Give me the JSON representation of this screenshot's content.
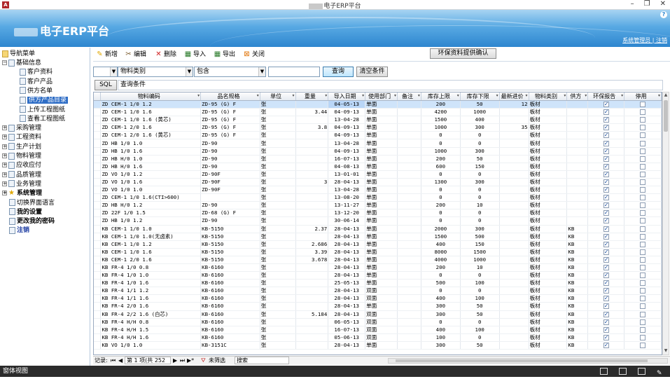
{
  "window": {
    "title": "电子ERP平台",
    "app_icon_letter": "A",
    "minimize": "–",
    "restore": "❐",
    "close": "✕"
  },
  "banner": {
    "brand": "电子ERP平台",
    "help": "?",
    "user_link": "系统管理员",
    "logout_link": "| 注销"
  },
  "nav": {
    "root": "导航菜单",
    "items": [
      {
        "label": "基础信息",
        "level": 1,
        "expander": "−"
      },
      {
        "label": "客户资料",
        "level": 2
      },
      {
        "label": "客户产品",
        "level": 2
      },
      {
        "label": "供方名单",
        "level": 2
      },
      {
        "label": "供方产品目录",
        "level": 2,
        "selected": true
      },
      {
        "label": "上传工程图纸",
        "level": 2
      },
      {
        "label": "查看工程图纸",
        "level": 2
      },
      {
        "label": "采购管理",
        "level": 1,
        "expander": "+"
      },
      {
        "label": "工程资料",
        "level": 1,
        "expander": "+"
      },
      {
        "label": "生产计划",
        "level": 1,
        "expander": "+"
      },
      {
        "label": "物料管理",
        "level": 1,
        "expander": "+"
      },
      {
        "label": "应收应付",
        "level": 1,
        "expander": "+"
      },
      {
        "label": "品质管理",
        "level": 1,
        "expander": "+"
      },
      {
        "label": "业务管理",
        "level": 1,
        "expander": "+"
      },
      {
        "label": "系统管理",
        "level": 1,
        "expander": "+",
        "bold": true,
        "star": true
      },
      {
        "label": "切换界面语言",
        "level": 1
      },
      {
        "label": "我的设置",
        "level": 1,
        "bold": true
      },
      {
        "label": "更改我的密码",
        "level": 1,
        "bold": true
      },
      {
        "label": "注销",
        "level": 1,
        "blue": true
      }
    ]
  },
  "toolbar": {
    "add": "新增",
    "edit": "编辑",
    "delete": "删除",
    "import": "导入",
    "export": "导出",
    "close": "关闭",
    "confirm": "环保资料提供确认"
  },
  "filter": {
    "field_prefix": "",
    "field": "物料类别",
    "operator": "包含",
    "value": "",
    "search_btn": "查询",
    "clear_btn": "清空条件",
    "sql_btn": "SQL",
    "sql_label": "查询条件"
  },
  "columns": [
    "物料编码",
    "品名规格",
    "单位",
    "重量",
    "导入日期",
    "使用部门",
    "备注",
    "库存上限",
    "库存下限",
    "最新进价",
    "物料类别",
    "供方",
    "环保报告",
    "停用"
  ],
  "rows": [
    [
      "ZD CEM-1 1/0 1.2",
      "ZD-95 (G) F",
      "张",
      "",
      "04-05-13",
      "单面",
      "",
      "200",
      "50",
      "12",
      "板材",
      "",
      1,
      0
    ],
    [
      "ZD CEM-1 1/0 1.6",
      "ZD-95 (G) F",
      "张",
      "3.44",
      "04-09-13",
      "单面",
      "",
      "4200",
      "1000",
      "",
      "板材",
      "",
      1,
      0
    ],
    [
      "ZD CEM-1 1/0 1.6 (黄芯)",
      "ZD-95 (G) F",
      "张",
      "",
      "13-04-28",
      "单面",
      "",
      "1500",
      "400",
      "",
      "板材",
      "",
      1,
      0
    ],
    [
      "ZD CEM-1 2/0 1.6",
      "ZD-95 (G) F",
      "张",
      "3.8",
      "04-09-13",
      "单面",
      "",
      "1000",
      "300",
      "35",
      "板材",
      "",
      1,
      0
    ],
    [
      "ZD CEM-1 2/0 1.6 (黄芯)",
      "ZD-95 (G) F",
      "张",
      "",
      "04-09-13",
      "单面",
      "",
      "0",
      "0",
      "",
      "板材",
      "",
      1,
      0
    ],
    [
      "ZD HB 1/0 1.0",
      "ZD-90",
      "张",
      "",
      "13-04-28",
      "单面",
      "",
      "0",
      "0",
      "",
      "板材",
      "",
      1,
      0
    ],
    [
      "ZD HB 1/0 1.6",
      "ZD-90",
      "张",
      "",
      "04-09-13",
      "单面",
      "",
      "1000",
      "300",
      "",
      "板材",
      "",
      1,
      0
    ],
    [
      "ZD HB H/0 1.0",
      "ZD-90",
      "张",
      "",
      "16-07-13",
      "单面",
      "",
      "200",
      "50",
      "",
      "板材",
      "",
      1,
      0
    ],
    [
      "ZD HB H/0 1.6",
      "ZD-90",
      "张",
      "",
      "04-08-13",
      "单面",
      "",
      "600",
      "150",
      "",
      "板材",
      "",
      1,
      0
    ],
    [
      "ZD VO  1/0 1.2",
      "ZD-90F",
      "张",
      "",
      "13-01-01",
      "单面",
      "",
      "0",
      "0",
      "",
      "板材",
      "",
      1,
      0
    ],
    [
      "ZD VO  1/0 1.6",
      "ZD-90F",
      "张",
      "3",
      "28-04-13",
      "单面",
      "",
      "1300",
      "300",
      "",
      "板材",
      "",
      1,
      0
    ],
    [
      "ZD VO 1/0 1.0",
      "ZD-90F",
      "张",
      "",
      "13-04-28",
      "单面",
      "",
      "0",
      "0",
      "",
      "板材",
      "",
      1,
      0
    ],
    [
      "ZD CEM-1 1/0 1.6(CTI>600)",
      "",
      "张",
      "",
      "13-08-20",
      "单面",
      "",
      "0",
      "0",
      "",
      "板材",
      "",
      1,
      0
    ],
    [
      "ZD HB H/0 1.2",
      "ZD-90",
      "张",
      "",
      "13-11-27",
      "单面",
      "",
      "200",
      "10",
      "",
      "板材",
      "",
      1,
      0
    ],
    [
      "ZD 22F 1/0 1.5",
      "ZD-68 (G) F",
      "张",
      "",
      "13-12-20",
      "单面",
      "",
      "0",
      "0",
      "",
      "板材",
      "",
      1,
      0
    ],
    [
      "ZD HB 1/0 1.2",
      "ZD-90",
      "张",
      "",
      "30-06-14",
      "单面",
      "",
      "0",
      "0",
      "",
      "板材",
      "",
      1,
      0
    ],
    [
      "KB CEM-1 1/0 1.0",
      "KB-5150",
      "张",
      "2.37",
      "28-04-13",
      "单面",
      "",
      "2000",
      "300",
      "",
      "板材",
      "KB",
      1,
      0
    ],
    [
      "KB CEM-1 1/0 1.0(无卤素)",
      "KB-5150",
      "张",
      "",
      "28-04-13",
      "单面",
      "",
      "1500",
      "500",
      "",
      "板材",
      "KB",
      1,
      0
    ],
    [
      "KB CEM-1 1/0 1.2",
      "KB-5150",
      "张",
      "2.686",
      "28-04-13",
      "单面",
      "",
      "400",
      "150",
      "",
      "板材",
      "KB",
      1,
      0
    ],
    [
      "KB CEM-1 1/0 1.6",
      "KB-5150",
      "张",
      "3.39",
      "28-04-13",
      "单面",
      "",
      "8000",
      "1500",
      "",
      "板材",
      "KB",
      1,
      0
    ],
    [
      "KB CEM-1 2/0 1.6",
      "KB-5150",
      "张",
      "3.678",
      "28-04-13",
      "单面",
      "",
      "4000",
      "1000",
      "",
      "板材",
      "KB",
      1,
      0
    ],
    [
      "KB FR-4 1/0 0.8",
      "KB-6160",
      "张",
      "",
      "28-04-13",
      "单面",
      "",
      "200",
      "10",
      "",
      "板材",
      "KB",
      1,
      0
    ],
    [
      "KB FR-4 1/0 1.0",
      "KB-6160",
      "张",
      "",
      "28-04-13",
      "单面",
      "",
      "0",
      "0",
      "",
      "板材",
      "KB",
      1,
      0
    ],
    [
      "KB FR-4 1/0 1.6",
      "KB-6160",
      "张",
      "",
      "25-05-13",
      "单面",
      "",
      "500",
      "100",
      "",
      "板材",
      "KB",
      1,
      0
    ],
    [
      "KB FR-4 1/1 1.2",
      "KB-6160",
      "张",
      "",
      "28-04-13",
      "双面",
      "",
      "0",
      "0",
      "",
      "板材",
      "KB",
      1,
      0
    ],
    [
      "KB FR-4 1/1 1.6",
      "KB-6160",
      "张",
      "",
      "28-04-13",
      "双面",
      "",
      "400",
      "100",
      "",
      "板材",
      "KB",
      1,
      0
    ],
    [
      "KB FR-4 2/0 1.6",
      "KB-6160",
      "张",
      "",
      "28-04-13",
      "单面",
      "",
      "300",
      "50",
      "",
      "板材",
      "KB",
      1,
      0
    ],
    [
      "KB FR-4 2/2 1.6 (白芯)",
      "KB-6160",
      "张",
      "5.184",
      "28-04-13",
      "双面",
      "",
      "300",
      "50",
      "",
      "板材",
      "KB",
      1,
      0
    ],
    [
      "KB FR-4 H/H 0.8",
      "KB-6160",
      "张",
      "",
      "06-05-13",
      "双面",
      "",
      "0",
      "0",
      "",
      "板材",
      "KB",
      1,
      0
    ],
    [
      "KB FR-4 H/H 1.5",
      "KB-6160",
      "张",
      "",
      "16-07-13",
      "双面",
      "",
      "400",
      "100",
      "",
      "板材",
      "KB",
      1,
      0
    ],
    [
      "KB FR-4 H/H 1.6",
      "KB-6160",
      "张",
      "",
      "05-06-13",
      "双面",
      "",
      "100",
      "0",
      "",
      "板材",
      "KB",
      1,
      0
    ],
    [
      "KB VO  1/0 1.0",
      "KB-3151C",
      "张",
      "",
      "28-04-13",
      "单面",
      "",
      "300",
      "50",
      "",
      "板材",
      "KB",
      1,
      0
    ]
  ],
  "recbar": {
    "label": "记录:",
    "first": "⏮",
    "prev": "◀",
    "position": "第 1 项(共 252 ",
    "next": "▶",
    "last": "⏭",
    "new": "▶*",
    "filter_state": "未筛选",
    "search": "搜索"
  },
  "statusbar": {
    "text": "窗体视图"
  },
  "colors": {
    "banner_top": "#a8d4f2",
    "banner_bottom": "#2e86cf",
    "selected_nav": "#2f6ec6",
    "selected_row": "#cfe4fa"
  }
}
